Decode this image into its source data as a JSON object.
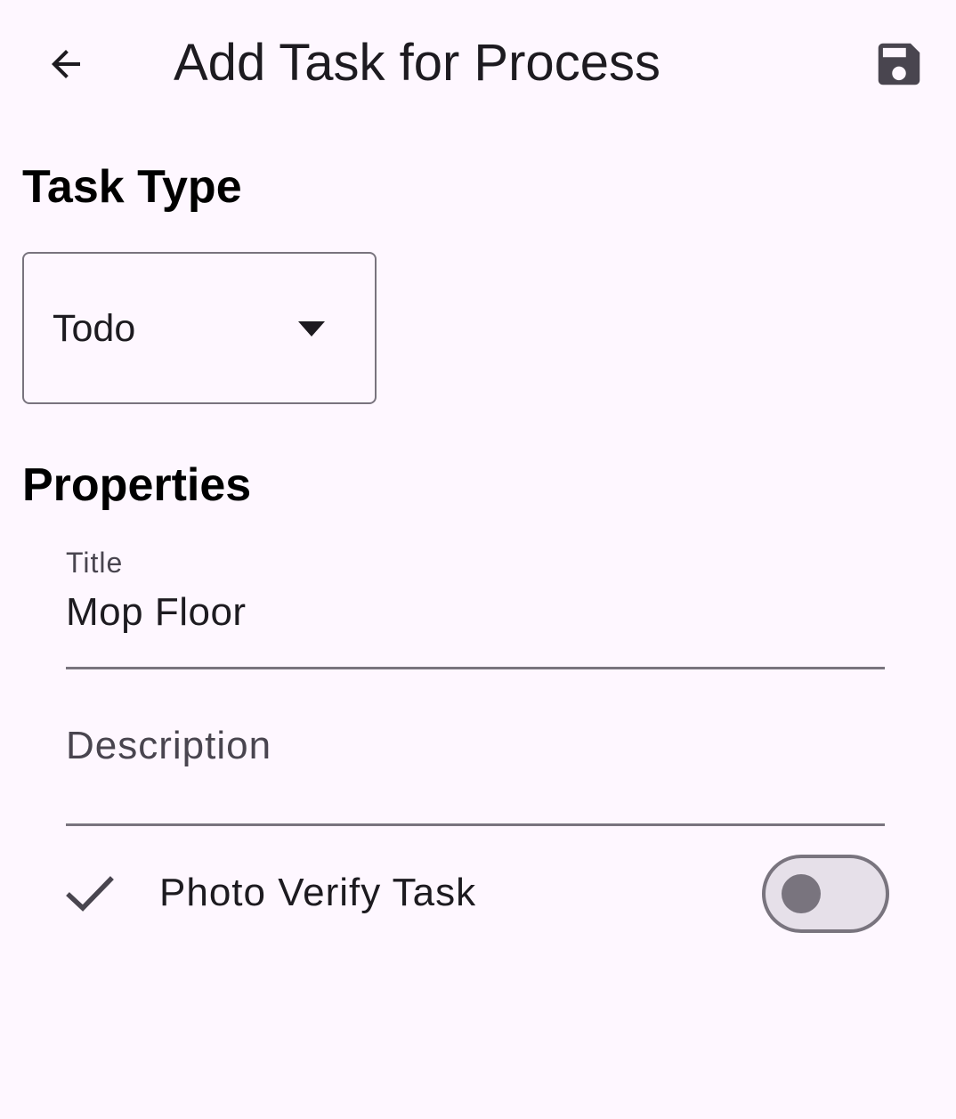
{
  "app_bar": {
    "title": "Add Task for Process",
    "back_icon": "arrow-back-icon",
    "save_icon": "save-icon"
  },
  "task_type": {
    "heading": "Task Type",
    "selected": "Todo",
    "caret_icon": "arrow-drop-down-icon"
  },
  "properties": {
    "heading": "Properties",
    "title_field": {
      "label": "Title",
      "value": "Mop Floor"
    },
    "description_field": {
      "placeholder": "Description",
      "value": ""
    },
    "photo_verify": {
      "icon": "check-icon",
      "label": "Photo Verify Task",
      "enabled": false
    }
  },
  "colors": {
    "background": "#FEF7FF",
    "on_surface": "#1D1B20",
    "outline": "#79747E",
    "switch_track": "#E6E0E9",
    "icon": "#49454F"
  }
}
